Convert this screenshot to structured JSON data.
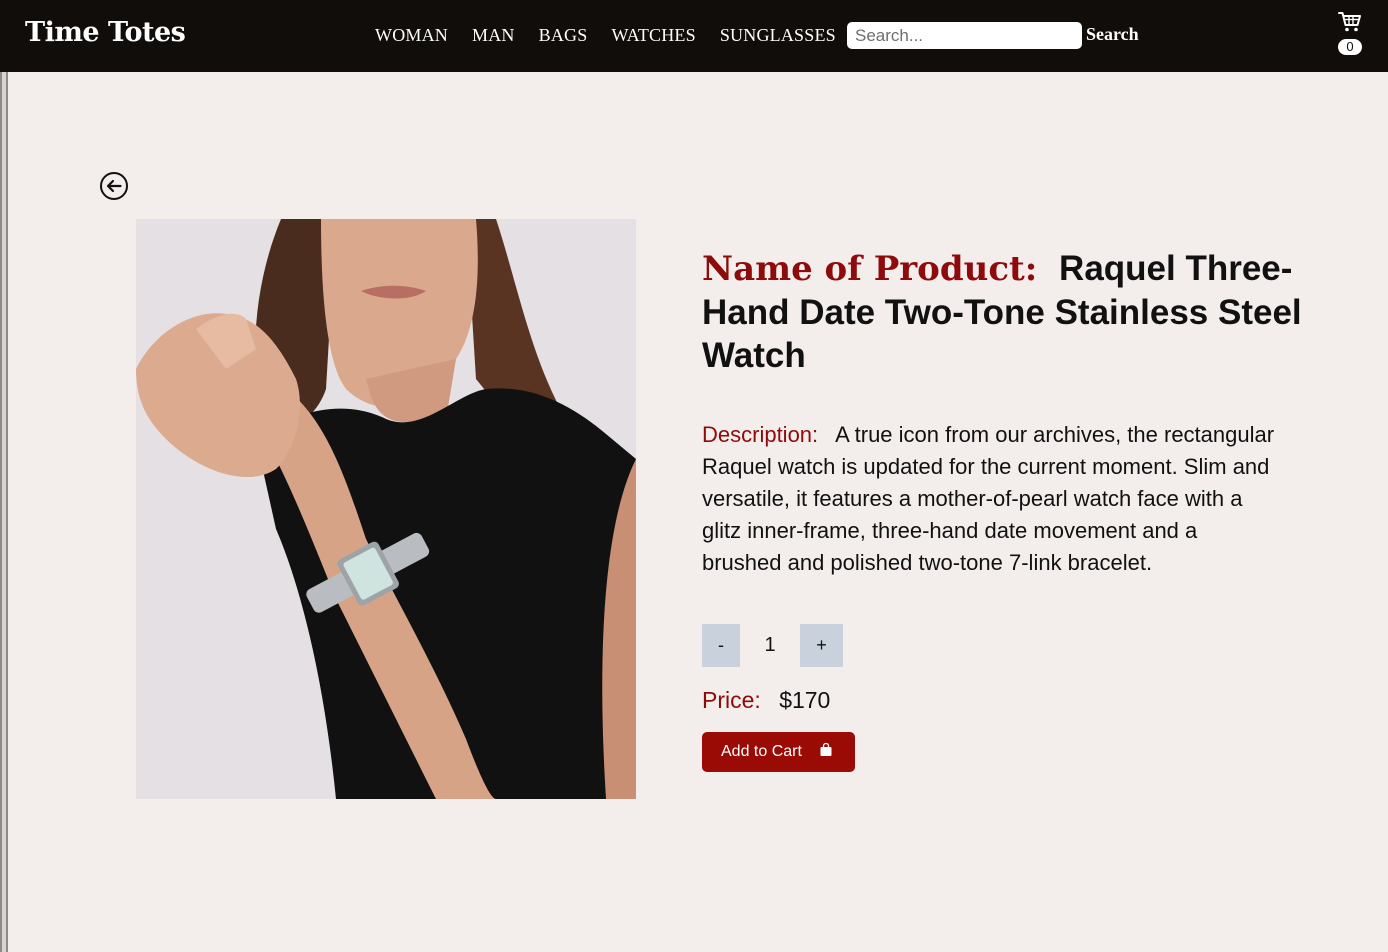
{
  "brand": "Time Totes",
  "nav": {
    "links": [
      "WOMAN",
      "MAN",
      "BAGS",
      "WATCHES",
      "SUNGLASSES"
    ],
    "search_placeholder": "Search...",
    "search_button": "Search",
    "cart_count": "0",
    "cart_icon": "cart-icon"
  },
  "product": {
    "name_label": "Name of Product:",
    "name": "Raquel Three-Hand Date Two-Tone Stainless Steel Watch",
    "description_label": "Description:",
    "description": "A true icon from our archives, the rectangular Raquel watch is updated for the current moment. Slim and versatile, it features a mother-of-pearl watch face with a glitz inner-frame, three-hand date movement and a brushed and polished two-tone 7-link bracelet.",
    "qty_minus": "-",
    "qty_plus": "+",
    "quantity": "1",
    "price_label": "Price:",
    "price": "$170",
    "add_to_cart": "Add to Cart"
  },
  "colors": {
    "navbar": "#110d0b",
    "background": "#f3eeec",
    "accent_red": "#8e0b0b",
    "button_red": "#9b0b05",
    "qty_button": "#c9d2dc"
  }
}
